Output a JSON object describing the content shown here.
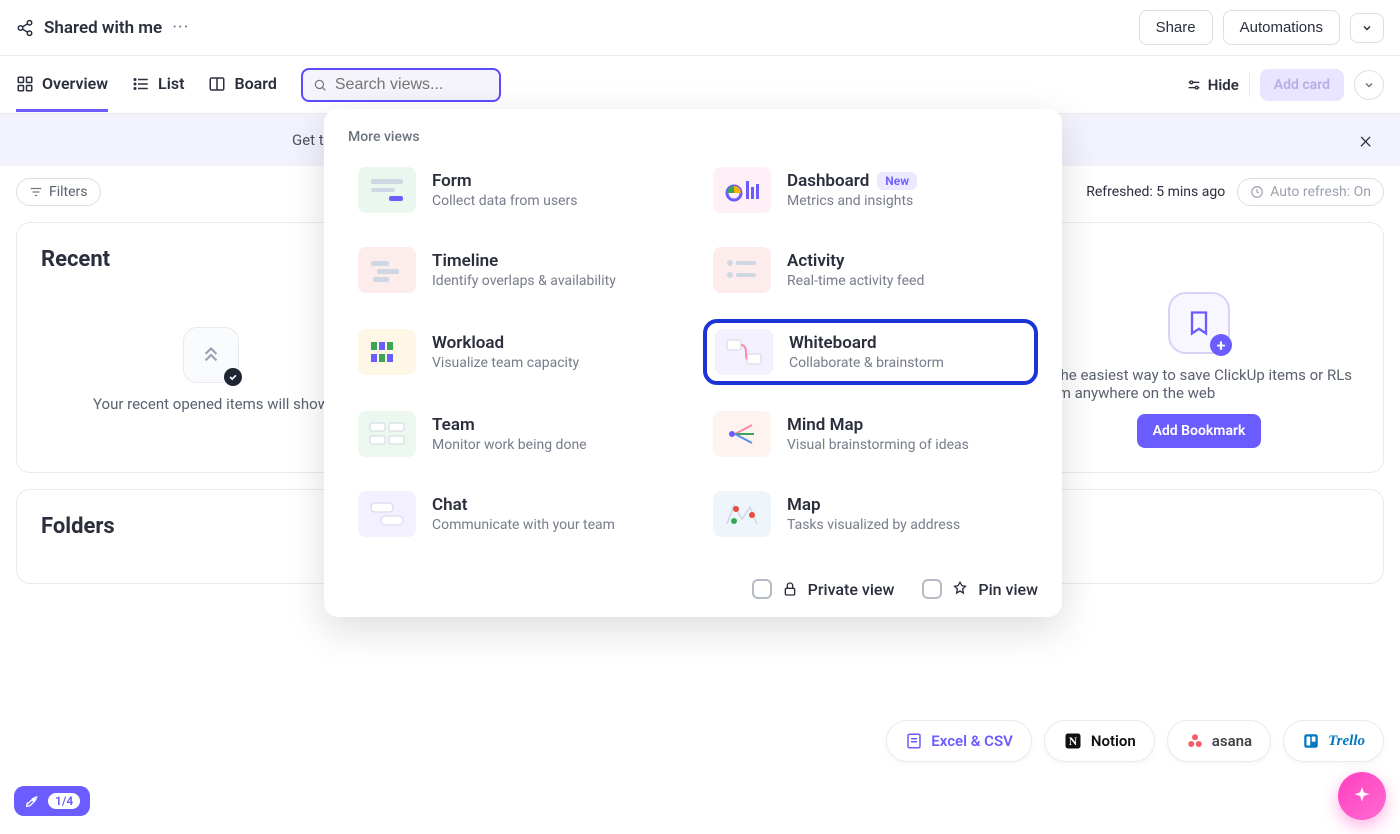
{
  "header": {
    "title": "Shared with me",
    "share_label": "Share",
    "automations_label": "Automations"
  },
  "tabs": {
    "overview": "Overview",
    "list": "List",
    "board": "Board",
    "search_placeholder": "Search views...",
    "hide_label": "Hide",
    "add_card_label": "Add card"
  },
  "banner": {
    "text_visible": "Get th"
  },
  "filters": {
    "filters_label": "Filters",
    "refreshed_label": "Refreshed: 5 mins ago",
    "auto_refresh_label": "Auto refresh: On"
  },
  "dropdown": {
    "heading": "More views",
    "items": [
      {
        "title": "Form",
        "desc": "Collect data from users",
        "thumb_bg": "#e9f7ef"
      },
      {
        "title": "Dashboard",
        "desc": "Metrics and insights",
        "badge": "New",
        "thumb_bg": "#fef0f6"
      },
      {
        "title": "Timeline",
        "desc": "Identify overlaps & availability",
        "thumb_bg": "#fdecec"
      },
      {
        "title": "Activity",
        "desc": "Real-time activity feed",
        "thumb_bg": "#fdecec"
      },
      {
        "title": "Workload",
        "desc": "Visualize team capacity",
        "thumb_bg": "#fff7e6"
      },
      {
        "title": "Whiteboard",
        "desc": "Collaborate & brainstorm",
        "highlighted": true,
        "thumb_bg": "#f3f0ff"
      },
      {
        "title": "Team",
        "desc": "Monitor work being done",
        "thumb_bg": "#ecf7ef"
      },
      {
        "title": "Mind Map",
        "desc": "Visual brainstorming of ideas",
        "thumb_bg": "#fdf4f0"
      },
      {
        "title": "Chat",
        "desc": "Communicate with your team",
        "thumb_bg": "#f3f0ff"
      },
      {
        "title": "Map",
        "desc": "Tasks visualized by address",
        "thumb_bg": "#eef6fb"
      }
    ],
    "private_label": "Private view",
    "pin_label": "Pin view"
  },
  "recent": {
    "heading": "Recent",
    "empty_text": "Your recent opened items will show",
    "bookmark_text": "re the easiest way to save ClickUp items or RLs from anywhere on the web",
    "add_bookmark_label": "Add Bookmark"
  },
  "folders": {
    "heading": "Folders"
  },
  "integrations": {
    "excel": "Excel & CSV",
    "notion": "Notion",
    "asana": "asana",
    "trello": "Trello"
  },
  "onboarding": {
    "count": "1/4"
  }
}
